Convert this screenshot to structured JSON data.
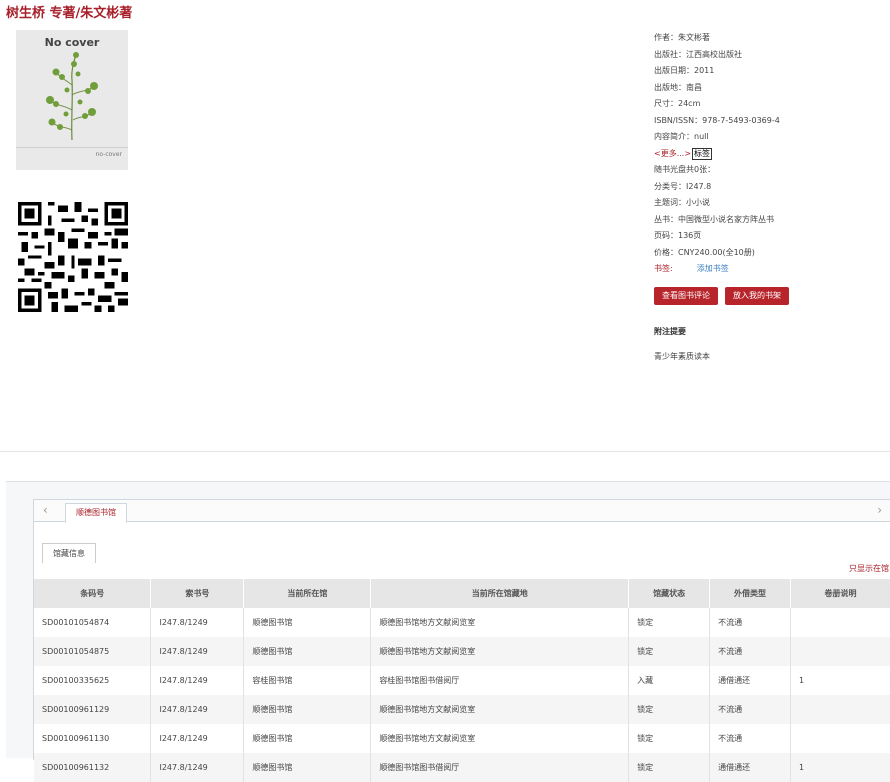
{
  "book": {
    "title": "树生桥 专著/朱文彬著",
    "cover": {
      "big": "No cover",
      "small": "no-cover"
    }
  },
  "info": {
    "rows": [
      "作者：朱文彬著",
      "出版社：江西高校出版社",
      "出版日期：2011",
      "出版地：南昌",
      "尺寸：24cm",
      "ISBN/ISSN：978-7-5493-0369-4",
      "内容简介：null"
    ],
    "more": "<更多...>",
    "tags_btn": "标签",
    "rows2": [
      "随书光盘共0张：",
      "分类号：I247.8",
      "主题词：小小说",
      "丛书：中国微型小说名家方阵丛书",
      "页码：136页",
      "价格：CNY240.00(全10册)"
    ],
    "tag_label": "书签:",
    "tag_add": "添加书签"
  },
  "buttons": {
    "review": "查看图书评论",
    "shelf": "放入我的书架"
  },
  "notes": {
    "heading": "附注提要",
    "text": "青少年素质读本"
  },
  "holdings": {
    "library_tab": "顺德图书馆",
    "sub_tab": "馆藏信息",
    "only_in": "只显示在馆",
    "columns": [
      "条码号",
      "索书号",
      "当前所在馆",
      "当前所在馆藏地",
      "馆藏状态",
      "外借类型",
      "卷册说明"
    ],
    "rows": [
      [
        "SD00101054874",
        "I247.8/1249",
        "顺德图书馆",
        "顺德图书馆地方文献阅览室",
        "锁定",
        "不流通",
        ""
      ],
      [
        "SD00101054875",
        "I247.8/1249",
        "顺德图书馆",
        "顺德图书馆地方文献阅览室",
        "锁定",
        "不流通",
        ""
      ],
      [
        "SD00100335625",
        "I247.8/1249",
        "容桂图书馆",
        "容桂图书馆图书借阅厅",
        "入藏",
        "通借通还",
        "1"
      ],
      [
        "SD00100961129",
        "I247.8/1249",
        "顺德图书馆",
        "顺德图书馆地方文献阅览室",
        "锁定",
        "不流通",
        ""
      ],
      [
        "SD00100961130",
        "I247.8/1249",
        "顺德图书馆",
        "顺德图书馆地方文献阅览室",
        "锁定",
        "不流通",
        ""
      ],
      [
        "SD00100961132",
        "I247.8/1249",
        "顺德图书馆",
        "顺德图书馆图书借阅厅",
        "锁定",
        "通借通还",
        "1"
      ]
    ]
  }
}
